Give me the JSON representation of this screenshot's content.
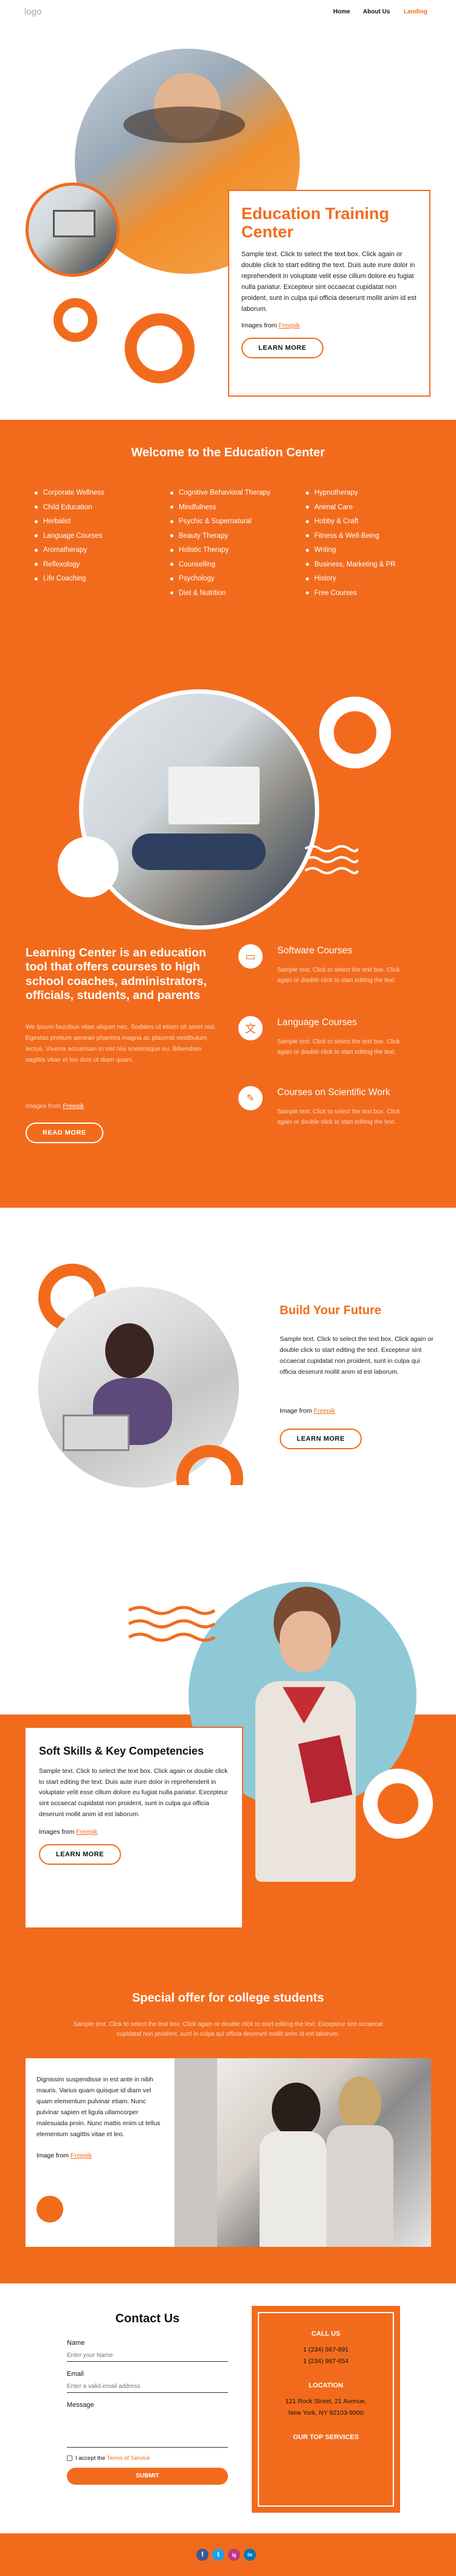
{
  "header": {
    "logo": "logo",
    "nav": [
      "Home",
      "About Us",
      "Landing"
    ]
  },
  "hero": {
    "title": "Education Training Center",
    "text": "Sample text. Click to select the text box. Click again or double click to start editing the text. Duis aute irure dolor in reprehenderit in voluptate velit esse cillum dolore eu fugiat nulla pariatur. Excepteur sint occaecat cupidatat non proident, sunt in culpa qui officia deserunt mollit anim id est laborum.",
    "images_from": "Images from",
    "images_link": "Freepik",
    "button": "LEARN MORE"
  },
  "welcome": {
    "title": "Welcome to the Education Center",
    "col1": [
      "Corporate Wellness",
      "Child Education",
      "Herbalist",
      "Language Courses",
      "Aromatherapy",
      "Reflexology",
      "Life Coaching"
    ],
    "col2": [
      "Cognitive Behavioral Therapy",
      "Mindfulness",
      "Psychic & Supernatural",
      "Beauty Therapy",
      "Holistic Therapy",
      "Counselling",
      "Psychology",
      "Diet & Nutrition"
    ],
    "col3": [
      "Hypnotherapy",
      "Animal Care",
      "Hobby & Craft",
      "Fitness & Well-Being",
      "Writing",
      "Business, Marketing & PR",
      "History",
      "Free Courses"
    ]
  },
  "learning": {
    "title": "Learning Center is an education tool that offers courses to high school coaches, administrators, officials, students, and parents",
    "text": "We ipsum faucibus vitae aliquet nec. Sodales ut etiam sit amet nisl. Egestas pretium aenean pharetra magna ac placerat vestibulum lectus. Viverra accumsan in nisl nisi scelerisque eu. Bibendum sagittis vitae et leo duis ut diam quam.",
    "images_from": "Images from",
    "images_link": "Freepik",
    "button": "READ MORE",
    "courses": [
      {
        "title": "Software Courses",
        "text": "Sample text. Click to select the text box. Click again or double click to start editing the text."
      },
      {
        "title": "Language Courses",
        "text": "Sample text. Click to select the text box. Click again or double click to start editing the text."
      },
      {
        "title": "Courses on Scientific Work",
        "text": "Sample text. Click to select the text box. Click again or double click to start editing the text."
      }
    ]
  },
  "future": {
    "title": "Build Your Future",
    "text": "Sample text. Click to select the text box. Click again or double click to start editing the text. Excepteur sint occaecat cupidatat non proident, sunt in culpa qui officia deserunt mollit anim id est laborum.",
    "images_from": "Image from",
    "images_link": "Freepik",
    "button": "LEARN MORE"
  },
  "skills": {
    "title": "Soft Skills & Key Competencies",
    "text": "Sample text. Click to select the text box. Click again or double click to start editing the text. Duis aute irure dolor in reprehenderit in voluptate velit esse cillum dolore eu fugiat nulla pariatur. Excepteur sint occaecat cupidatat non proident, sunt in culpa qui officia deserunt mollit anim id est laborum.",
    "images_from": "Images from",
    "images_link": "Freepik",
    "button": "LEARN MORE"
  },
  "offer": {
    "title": "Special offer for  college students",
    "subtitle": "Sample text. Click to select the text box. Click again or double click to start editing the text. Excepteur sint occaecat cupidatat non proident, sunt in culpa qui officia deserunt mollit anim id est laborum.",
    "text": "Dignissim suspendisse in est ante in nibh mauris. Varius quam quisque id diam vel quam elementum pulvinar etiam. Nunc pulvinar sapien et ligula ullamcorper malesuada proin. Nunc mattis enim ut tellus elementum sagittis vitae et leo.",
    "images_from": "Image from",
    "images_link": "Freepik"
  },
  "contact": {
    "title": "Contact Us",
    "name_label": "Name",
    "name_placeholder": "Enter your Name",
    "email_label": "Email",
    "email_placeholder": "Enter a valid email address",
    "message_label": "Message",
    "accept_text": "I accept the",
    "terms_link": "Terms of Service",
    "submit": "SUBMIT",
    "call_title": "CALL US",
    "phones": [
      "1 (234) 567-891",
      "1 (234) 987-654"
    ],
    "location_title": "LOCATION",
    "address": [
      "121 Rock Street, 21 Avenue,",
      "New York, NY 92103-9000"
    ],
    "services_title": "OUR TOP SERVICES"
  },
  "footer": {
    "socials": [
      "f",
      "t",
      "ig",
      "in"
    ]
  },
  "colors": {
    "accent": "#f26b1d",
    "light_blue": "#8fc9d6"
  }
}
